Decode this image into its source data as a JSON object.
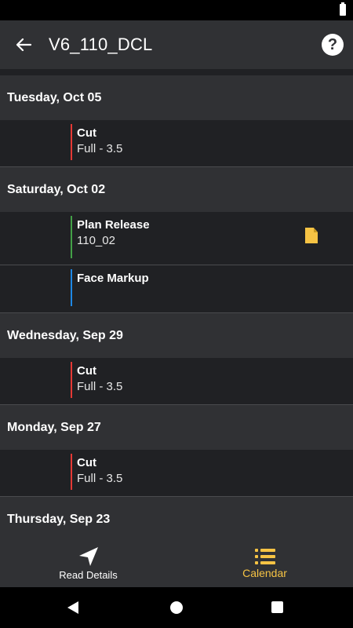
{
  "app_bar": {
    "title": "V6_110_DCL",
    "back_icon": "arrow-left-icon",
    "help_icon": "help-circle-icon"
  },
  "sections": [
    {
      "date": "Tuesday, Oct 05",
      "events": [
        {
          "title": "Cut",
          "subtitle": "Full - 3.5",
          "bar_color": "#e53935"
        }
      ]
    },
    {
      "date": "Saturday, Oct 02",
      "events": [
        {
          "title": "Plan Release",
          "subtitle": "110_02",
          "bar_color": "#43a047",
          "icon": "file-icon",
          "icon_color": "#f6c344"
        },
        {
          "title": "Face Markup",
          "subtitle": "",
          "bar_color": "#1e88e5"
        }
      ]
    },
    {
      "date": "Wednesday, Sep 29",
      "events": [
        {
          "title": "Cut",
          "subtitle": "Full - 3.5",
          "bar_color": "#e53935"
        }
      ]
    },
    {
      "date": "Monday, Sep 27",
      "events": [
        {
          "title": "Cut",
          "subtitle": "Full - 3.5",
          "bar_color": "#e53935"
        }
      ]
    },
    {
      "date": "Thursday, Sep 23",
      "events": []
    }
  ],
  "bottom_nav": {
    "items": [
      {
        "label": "Read Details",
        "icon": "navigation-arrow-icon",
        "active": false
      },
      {
        "label": "Calendar",
        "icon": "list-icon",
        "active": true
      }
    ],
    "accent_color": "#f6c344"
  },
  "system_nav": {
    "back_icon": "triangle-back-icon",
    "home_icon": "circle-home-icon",
    "recents_icon": "square-recents-icon"
  }
}
